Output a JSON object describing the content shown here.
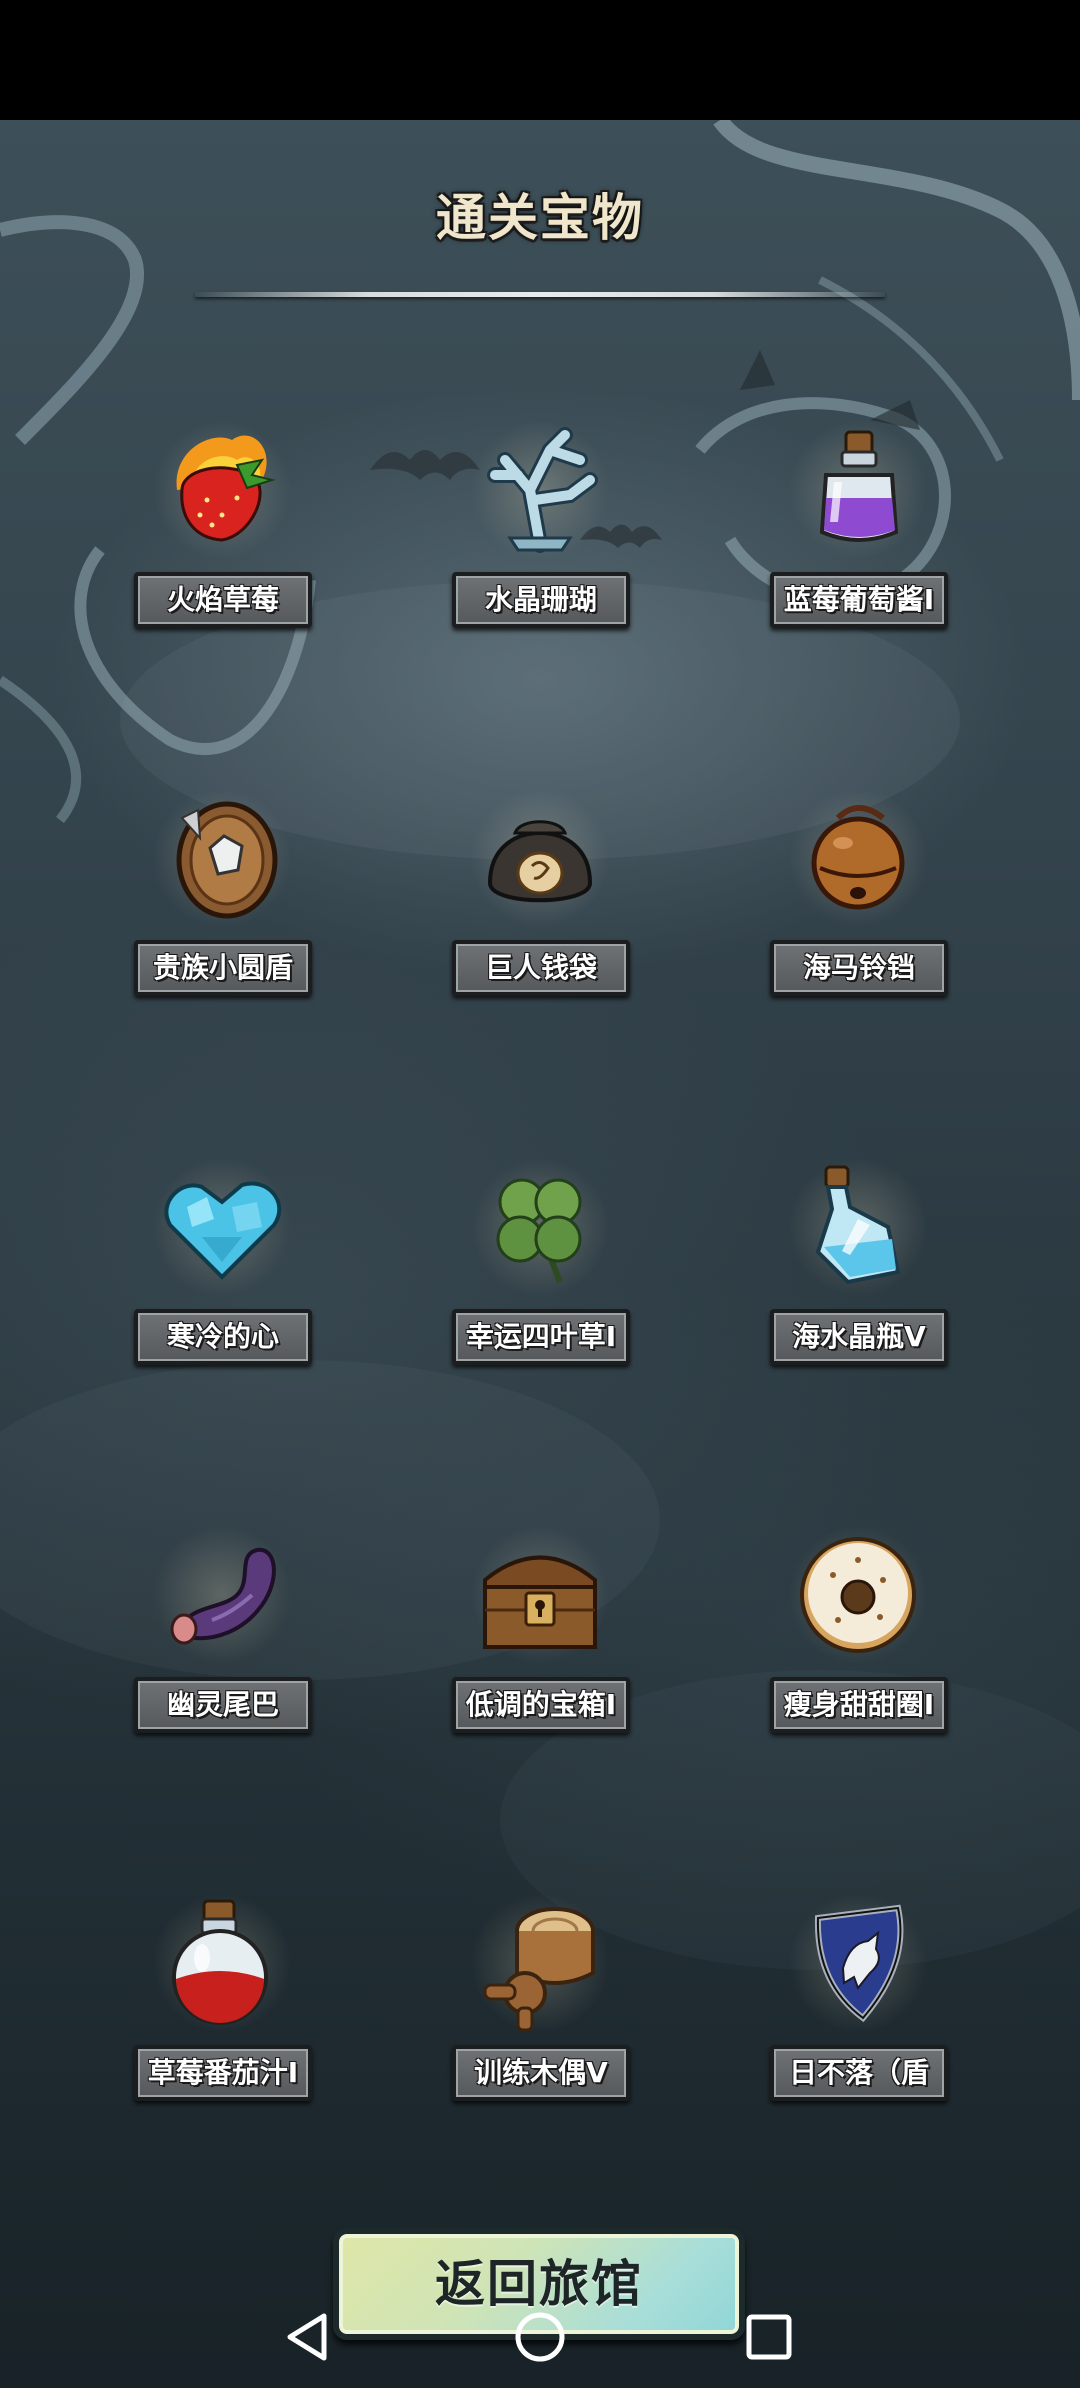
{
  "header": {
    "title": "通关宝物"
  },
  "items": [
    {
      "label": "火焰草莓",
      "icon": "flame-strawberry-icon"
    },
    {
      "label": "水晶珊瑚",
      "icon": "crystal-coral-icon"
    },
    {
      "label": "蓝莓葡萄酱I",
      "icon": "purple-potion-icon"
    },
    {
      "label": "贵族小圆盾",
      "icon": "round-shield-icon"
    },
    {
      "label": "巨人钱袋",
      "icon": "money-bag-icon"
    },
    {
      "label": "海马铃铛",
      "icon": "bell-icon"
    },
    {
      "label": "寒冷的心",
      "icon": "ice-heart-icon"
    },
    {
      "label": "幸运四叶草I",
      "icon": "four-leaf-clover-icon"
    },
    {
      "label": "海水晶瓶V",
      "icon": "blue-bottle-icon"
    },
    {
      "label": "幽灵尾巴",
      "icon": "ghost-tail-icon"
    },
    {
      "label": "低调的宝箱I",
      "icon": "treasure-chest-icon"
    },
    {
      "label": "瘦身甜甜圈I",
      "icon": "donut-icon"
    },
    {
      "label": "草莓番茄汁I",
      "icon": "red-potion-icon"
    },
    {
      "label": "训练木偶V",
      "icon": "wooden-dummy-icon"
    },
    {
      "label": "日不落（盾",
      "icon": "blue-shield-icon"
    }
  ],
  "footer": {
    "return_label": "返回旅馆"
  },
  "nav": {
    "back": "back-triangle-icon",
    "home": "home-circle-icon",
    "recents": "recents-square-icon"
  }
}
